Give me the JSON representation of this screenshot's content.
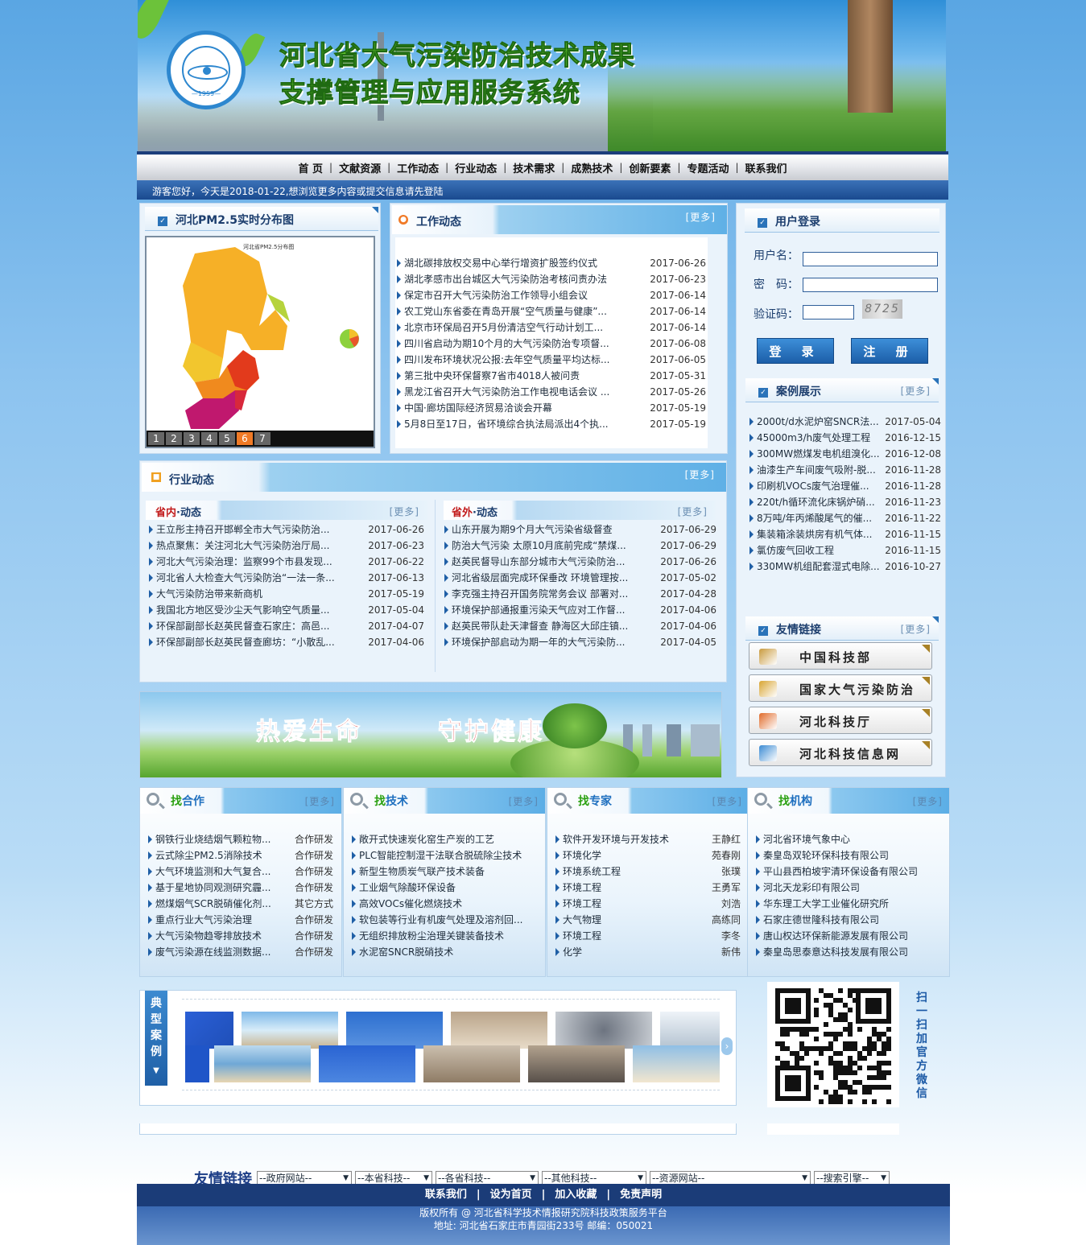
{
  "header": {
    "title_line1": "河北省大气污染防治技术成果",
    "title_line2": "支撑管理与应用服务系统",
    "logo_year": "—1959—"
  },
  "nav": {
    "items": [
      "首 页",
      "文献资源",
      "工作动态",
      "行业动态",
      "技术需求",
      "成熟技术",
      "创新要素",
      "专题活动",
      "联系我们"
    ]
  },
  "welcome": "游客您好，今天是2018-01-22,想浏览更多内容或提交信息请先登陆",
  "map_panel": {
    "title": "河北PM2.5实时分布图",
    "pages": [
      "1",
      "2",
      "3",
      "4",
      "5",
      "6",
      "7"
    ],
    "active_page": "6"
  },
  "work_news": {
    "title": "工作动态",
    "more": "[更多]",
    "items": [
      {
        "text": "湖北碳排放权交易中心举行增资扩股签约仪式",
        "date": "2017-06-26"
      },
      {
        "text": "湖北孝感市出台城区大气污染防治考核问责办法",
        "date": "2017-06-23"
      },
      {
        "text": "保定市召开大气污染防治工作领导小组会议",
        "date": "2017-06-14"
      },
      {
        "text": "农工党山东省委在青岛开展“空气质量与健康”...",
        "date": "2017-06-14"
      },
      {
        "text": "北京市环保局召开5月份清洁空气行动计划工...",
        "date": "2017-06-14"
      },
      {
        "text": "四川省启动为期10个月的大气污染防治专项督...",
        "date": "2017-06-08"
      },
      {
        "text": "四川发布环境状况公报:去年空气质量平均达标...",
        "date": "2017-06-05"
      },
      {
        "text": "第三批中央环保督察7省市4018人被问责",
        "date": "2017-05-31"
      },
      {
        "text": "黑龙江省召开大气污染防治工作电视电话会议 ...",
        "date": "2017-05-26"
      },
      {
        "text": "中国·廊坊国际经济贸易洽谈会开幕",
        "date": "2017-05-19"
      },
      {
        "text": "5月8日至17日，省环境综合执法局派出4个执...",
        "date": "2017-05-19"
      }
    ]
  },
  "login": {
    "title": "用户登录",
    "username_label": "用户名：",
    "password_label": "密　码：",
    "captcha_label": "验证码：",
    "captcha_text": "8725",
    "login_btn": "登 录",
    "register_btn": "注 册"
  },
  "cases": {
    "title": "案例展示",
    "more": "[更多]",
    "items": [
      {
        "text": "2000t/d水泥炉窑SNCR法...",
        "date": "2017-05-04"
      },
      {
        "text": "45000m3/h废气处理工程",
        "date": "2016-12-15"
      },
      {
        "text": "300MW燃煤发电机组溴化...",
        "date": "2016-12-08"
      },
      {
        "text": "油漆生产车间废气吸附-脱...",
        "date": "2016-11-28"
      },
      {
        "text": "印刷机VOCs废气治理催...",
        "date": "2016-11-28"
      },
      {
        "text": "220t/h循环流化床锅炉硝...",
        "date": "2016-11-23"
      },
      {
        "text": "8万吨/年丙烯酸尾气的催...",
        "date": "2016-11-22"
      },
      {
        "text": "集装箱涂装烘房有机气体...",
        "date": "2016-11-15"
      },
      {
        "text": "氯仿废气回收工程",
        "date": "2016-11-15"
      },
      {
        "text": "330MW机组配套湿式电除...",
        "date": "2016-10-27"
      }
    ]
  },
  "industry": {
    "title": "行业动态",
    "more": "[更多]",
    "domestic": {
      "title_a": "省内",
      "title_b": "·动态",
      "more": "[更多]",
      "items": [
        {
          "text": "王立彤主持召开邯郸全市大气污染防治...",
          "date": "2017-06-26"
        },
        {
          "text": "热点聚焦：关注河北大气污染防治厅局...",
          "date": "2017-06-23"
        },
        {
          "text": "河北大气污染治理：监察99个市县发现...",
          "date": "2017-06-22"
        },
        {
          "text": "河北省人大检查大气污染防治“一法一条...",
          "date": "2017-06-13"
        },
        {
          "text": "大气污染防治带来新商机",
          "date": "2017-05-19"
        },
        {
          "text": "我国北方地区受沙尘天气影响空气质量...",
          "date": "2017-05-04"
        },
        {
          "text": "环保部副部长赵英民督查石家庄：高邑...",
          "date": "2017-04-07"
        },
        {
          "text": "环保部副部长赵英民督查廊坊：“小散乱...",
          "date": "2017-04-06"
        }
      ]
    },
    "abroad": {
      "title_a": "省外",
      "title_b": "·动态",
      "more": "[更多]",
      "items": [
        {
          "text": "山东开展为期9个月大气污染省级督查",
          "date": "2017-06-29"
        },
        {
          "text": "防治大气污染 太原10月底前完成“禁煤...",
          "date": "2017-06-29"
        },
        {
          "text": "赵英民督导山东部分城市大气污染防治...",
          "date": "2017-06-26"
        },
        {
          "text": "河北省级层面完成环保垂改 环境管理按...",
          "date": "2017-05-02"
        },
        {
          "text": "李克强主持召开国务院常务会议 部署对...",
          "date": "2017-04-28"
        },
        {
          "text": "环境保护部通报重污染天气应对工作督...",
          "date": "2017-04-06"
        },
        {
          "text": "赵英民带队赴天津督查 静海区大邱庄镇...",
          "date": "2017-04-06"
        },
        {
          "text": "环境保护部启动为期一年的大气污染防...",
          "date": "2017-04-05"
        }
      ]
    }
  },
  "friend_links": {
    "title": "友情链接",
    "more": "[更多]",
    "items": [
      "中国科技部",
      "国家大气污染防治",
      "河北科技厅",
      "河北科技信息网"
    ]
  },
  "banner": {
    "text1": "热爱生命",
    "text2": "守护健康"
  },
  "find_cooperation": {
    "prefix": "找",
    "title": "合作",
    "more": "[更多]",
    "items": [
      {
        "text": "钢铁行业烧结烟气颗粒物...",
        "tag": "合作研发"
      },
      {
        "text": "云式除尘PM2.5消除技术",
        "tag": "合作研发"
      },
      {
        "text": "大气环境监测和大气复合...",
        "tag": "合作研发"
      },
      {
        "text": "基于星地协同观测研究霾...",
        "tag": "合作研发"
      },
      {
        "text": "燃煤烟气SCR脱硝催化剂...",
        "tag": "其它方式"
      },
      {
        "text": "重点行业大气污染治理",
        "tag": "合作研发"
      },
      {
        "text": "大气污染物趋零排放技术",
        "tag": "合作研发"
      },
      {
        "text": "废气污染源在线监测数据...",
        "tag": "合作研发"
      }
    ]
  },
  "find_tech": {
    "prefix": "找",
    "title": "技术",
    "more": "[更多]",
    "items": [
      {
        "text": "敞开式快速炭化窑生产炭的工艺",
        "tag": ""
      },
      {
        "text": "PLC智能控制湿干法联合脱硫除尘技术",
        "tag": ""
      },
      {
        "text": "新型生物质炭气联产技术装备",
        "tag": ""
      },
      {
        "text": "工业烟气除酸环保设备",
        "tag": ""
      },
      {
        "text": "高效VOCs催化燃烧技术",
        "tag": ""
      },
      {
        "text": "软包装等行业有机废气处理及溶剂回...",
        "tag": ""
      },
      {
        "text": "无组织排放粉尘治理关键装备技术",
        "tag": ""
      },
      {
        "text": "水泥窑SNCR脱硝技术",
        "tag": ""
      }
    ]
  },
  "find_expert": {
    "prefix": "找",
    "title": "专家",
    "more": "[更多]",
    "items": [
      {
        "text": "软件开发环境与开发技术",
        "tag": "王静红"
      },
      {
        "text": "环境化学",
        "tag": "苑春刚"
      },
      {
        "text": "环境系统工程",
        "tag": "张璞"
      },
      {
        "text": "环境工程",
        "tag": "王勇军"
      },
      {
        "text": "环境工程",
        "tag": "刘浩"
      },
      {
        "text": "大气物理",
        "tag": "高练同"
      },
      {
        "text": "环境工程",
        "tag": "李冬"
      },
      {
        "text": "化学",
        "tag": "新伟"
      }
    ]
  },
  "find_org": {
    "prefix": "找",
    "title": "机构",
    "more": "[更多]",
    "items": [
      {
        "text": "河北省环境气象中心",
        "tag": ""
      },
      {
        "text": "秦皇岛双轮环保科技有限公司",
        "tag": ""
      },
      {
        "text": "平山县西柏坡宇清环保设备有限公司",
        "tag": ""
      },
      {
        "text": "河北天龙彩印有限公司",
        "tag": ""
      },
      {
        "text": "华东理工大学工业催化研究所",
        "tag": ""
      },
      {
        "text": "石家庄德世隆科技有限公司",
        "tag": ""
      },
      {
        "text": "唐山权达环保新能源发展有限公司",
        "tag": ""
      },
      {
        "text": "秦皇岛思泰意达科技发展有限公司",
        "tag": ""
      }
    ]
  },
  "gallery": {
    "side_label": "典型案例"
  },
  "qr": {
    "text": "扫一扫加官方微信"
  },
  "footer_links": {
    "label": "友情链接",
    "selects": [
      "--政府网站--",
      "--本省科技--",
      "--各省科技--",
      "--其他科技--",
      "--资源网站--",
      "--搜索引擎--"
    ]
  },
  "footer": {
    "nav": [
      "联系我们",
      "设为首页",
      "加入收藏",
      "免责声明"
    ],
    "copyright": "版权所有 @ 河北省科学技术情报研究院科技政策服务平台",
    "address": "地址: 河北省石家庄市青园街233号 邮编：050021"
  },
  "colors": {
    "primary": "#1c3e7b",
    "accent": "#2a73b9",
    "find_green": "#2aa010"
  }
}
